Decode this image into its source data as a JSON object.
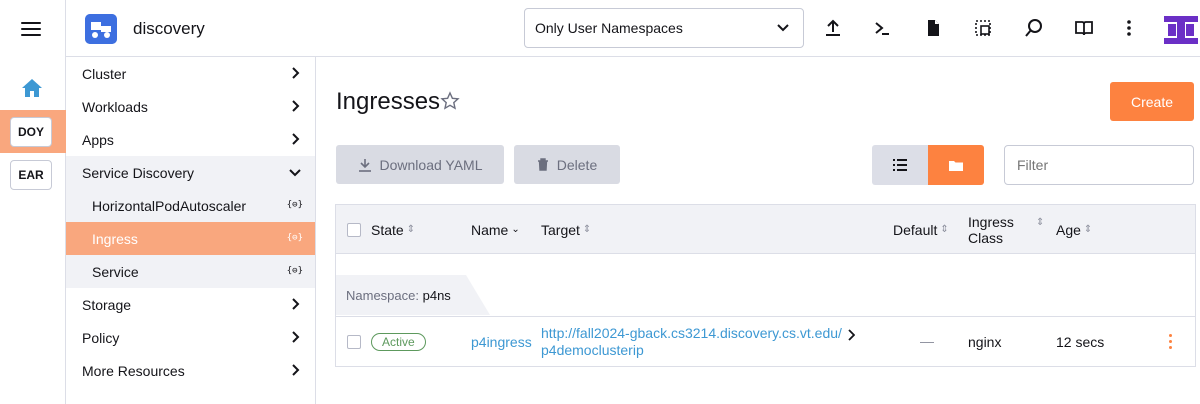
{
  "rail": {
    "clusters": [
      {
        "label": "DOY",
        "active": true
      },
      {
        "label": "EAR",
        "active": false
      }
    ]
  },
  "header": {
    "product": "discovery",
    "namespace_filter": "Only User Namespaces",
    "icons": [
      "upload-icon",
      "terminal-icon",
      "file-icon",
      "copy-config-icon",
      "search-icon",
      "docs-icon",
      "more-vertical-icon"
    ]
  },
  "sidenav": {
    "items": [
      {
        "label": "Cluster"
      },
      {
        "label": "Workloads"
      },
      {
        "label": "Apps"
      },
      {
        "label": "Service Discovery"
      },
      {
        "label": "HorizontalPodAutoscaler",
        "badge": "{⊖}"
      },
      {
        "label": "Ingress",
        "badge": "{⊖}"
      },
      {
        "label": "Service",
        "badge": "{⊖}"
      },
      {
        "label": "Storage"
      },
      {
        "label": "Policy"
      },
      {
        "label": "More Resources"
      }
    ]
  },
  "main": {
    "title": "Ingresses",
    "create_label": "Create",
    "download_label": "Download YAML",
    "delete_label": "Delete",
    "filter_placeholder": "Filter"
  },
  "table": {
    "columns": {
      "state": "State",
      "name": "Name",
      "target": "Target",
      "default": "Default",
      "ingress_class_1": "Ingress",
      "ingress_class_2": "Class",
      "age": "Age"
    },
    "group_label": "Namespace:",
    "group_value": "p4ns",
    "rows": [
      {
        "state": "Active",
        "name": "p4ingress",
        "target_line1": "http://fall2024-gback.cs3214.discovery.cs.vt.edu/",
        "target_line2": "p4democlusterip",
        "default": "—",
        "ingress_class": "nginx",
        "age": "12 secs"
      }
    ]
  },
  "colors": {
    "accent": "#fd8240",
    "active_nav": "#f9a77e",
    "link": "#3d98d3",
    "success": "#5d995d"
  }
}
